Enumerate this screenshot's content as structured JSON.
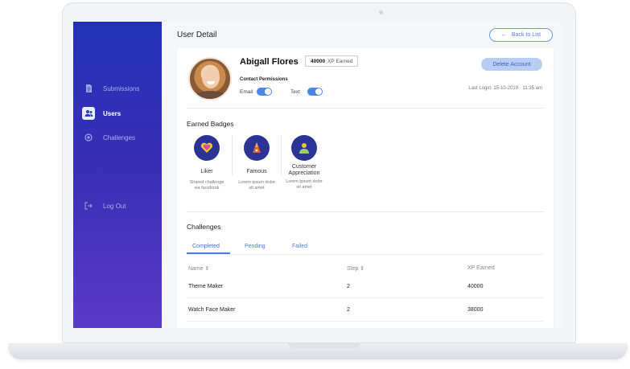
{
  "sidebar": {
    "items": [
      {
        "label": "Submissions",
        "icon": "document-icon"
      },
      {
        "label": "Users",
        "icon": "users-icon"
      },
      {
        "label": "Challenges",
        "icon": "challenge-icon"
      },
      {
        "label": "Log Out",
        "icon": "logout-icon"
      }
    ],
    "active": "Users"
  },
  "header": {
    "title": "User Detail",
    "back_label": "Back to List"
  },
  "profile": {
    "name": "Abigall Flores",
    "xp_value": "40000",
    "xp_label": "XP Earned",
    "delete_label": "Delete Account",
    "permissions_title": "Contact Permissions",
    "permissions": [
      {
        "label": "Email",
        "enabled": true
      },
      {
        "label": "Text",
        "enabled": true
      }
    ],
    "last_login": "Last Login: 15-10-2019 · 11:35 am"
  },
  "badges": {
    "title": "Earned Badges",
    "items": [
      {
        "name": "Liker",
        "desc1": "Shared challenge",
        "desc2": "via facebook",
        "icon": "heart-icon",
        "color": "#f1c232"
      },
      {
        "name": "Famous",
        "desc1": "Lorem ipsum dolor",
        "desc2": "sit amet",
        "icon": "cone-icon",
        "color": "#e8622e"
      },
      {
        "name": "Customer",
        "name2": "Appreciation",
        "desc1": "Lorem ipsum dolor",
        "desc2": "sit amet",
        "icon": "person-icon",
        "color": "#9bd16a"
      }
    ]
  },
  "challenges": {
    "title": "Challenges",
    "tabs": [
      "Completed",
      "Pending",
      "Failed"
    ],
    "active_tab": "Completed",
    "columns": [
      "Name ⇕",
      "Step ⇕",
      "XP Earned"
    ],
    "rows": [
      {
        "name": "Theme Maker",
        "step": "2",
        "xp": "40000"
      },
      {
        "name": "Watch Face Maker",
        "step": "2",
        "xp": "38000"
      }
    ]
  },
  "colors": {
    "sidebar_top": "#2230b8",
    "sidebar_bottom": "#5a3ac8",
    "accent": "#4b7ed9"
  }
}
